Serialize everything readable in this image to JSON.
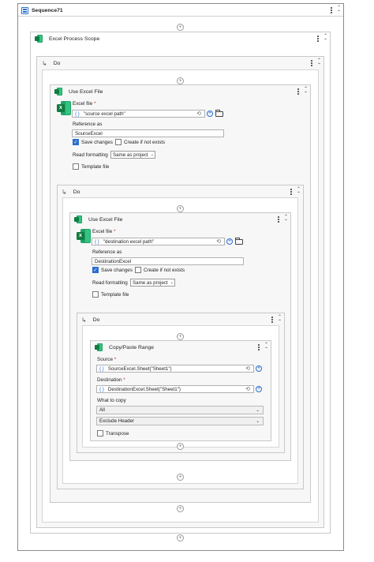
{
  "sequence": {
    "title": "Sequence71"
  },
  "excel_scope": {
    "title": "Excel Process Scope"
  },
  "do_labels": [
    "Do",
    "Do",
    "Do"
  ],
  "use_excel_1": {
    "title": "Use Excel File",
    "excel_file_label": "Excel file",
    "required_mark": "*",
    "excel_file_value": "\"source excel path\"",
    "reference_label": "Reference as",
    "reference_value": "SourceExcel",
    "save_changes": "Save changes",
    "create_if_not_exists": "Create if not exists",
    "read_formatting_label": "Read formatting",
    "read_formatting_value": "Same as project",
    "template_file": "Template file"
  },
  "use_excel_2": {
    "title": "Use Excel File",
    "excel_file_label": "Excel file",
    "required_mark": "*",
    "excel_file_value": "\"destination excel path\"",
    "reference_label": "Reference as",
    "reference_value": "DestinationExcel",
    "save_changes": "Save changes",
    "create_if_not_exists": "Create if not exists",
    "read_formatting_label": "Read formatting",
    "read_formatting_value": "Same as project",
    "template_file": "Template file"
  },
  "copy_paste": {
    "title": "Copy/Paste Range",
    "source_label": "Source",
    "source_value": "SourceExcel.Sheet(\"Sheet1\")",
    "destination_label": "Destination",
    "destination_value": "DestinationExcel.Sheet(\"Sheet1\")",
    "what_to_copy_label": "What to copy",
    "what_to_copy_value": "All",
    "header_option": "Exclude Header",
    "transpose": "Transpose",
    "required_mark": "*"
  },
  "icons": {
    "brace": "{ }",
    "plus": "+",
    "refresh": "⟲",
    "check": "✓",
    "chevron_down": "⌄",
    "collapse": "⌃⌃",
    "do_arrow": "↳",
    "sequence_icon": "sequence-icon",
    "excel_icon": "excel-icon",
    "folder_icon": "folder-icon"
  }
}
